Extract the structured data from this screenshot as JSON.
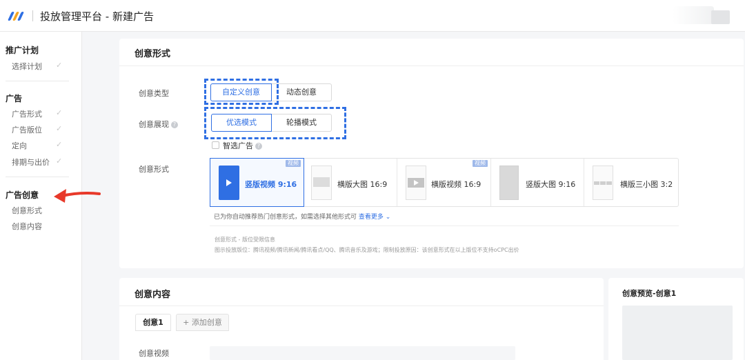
{
  "header": {
    "app_title": "投放管理平台 - 新建广告"
  },
  "sidebar": {
    "groups": [
      {
        "label": "推广计划",
        "items": [
          {
            "label": "选择计划",
            "check": "✓"
          }
        ]
      },
      {
        "label": "广告",
        "items": [
          {
            "label": "广告形式",
            "check": "✓"
          },
          {
            "label": "广告版位",
            "check": "✓"
          },
          {
            "label": "定向",
            "check": "✓"
          },
          {
            "label": "排期与出价",
            "check": "✓"
          }
        ]
      },
      {
        "label": "广告创意",
        "items": [
          {
            "label": "创意形式"
          },
          {
            "label": "创意内容"
          }
        ]
      }
    ],
    "arrow_color": "#e8392a"
  },
  "format_panel": {
    "title": "创意形式",
    "type_label": "创意类型",
    "type_options": [
      "自定义创意",
      "动态创意"
    ],
    "type_selected": "自定义创意",
    "display_label": "创意展现",
    "display_options": [
      "优选模式",
      "轮播模式"
    ],
    "display_selected": "优选模式",
    "smart_ad_label": "智选广告",
    "form_label": "创意形式",
    "formats": [
      {
        "label": "竖版视频 9:16",
        "tag": "视频",
        "selected": true,
        "icon": "play-icon"
      },
      {
        "label": "横版大图 16:9",
        "tag": ""
      },
      {
        "label": "横版视频 16:9",
        "tag": "视频",
        "icon": "play-icon"
      },
      {
        "label": "竖版大图 9:16",
        "tag": ""
      },
      {
        "label": "横版三小图 3:2",
        "tag": ""
      }
    ],
    "hint_text": "已为你自动推荐热门创意形式，如需选择其他形式可",
    "hint_link": "查看更多",
    "note_title": "创意形式 - 版位受限信息",
    "note_text": "图示投放版位：腾讯视频/腾讯新闻/腾讯看点/QQ、腾讯音乐及游戏；限制投放原因：该创意形式在以上版位不支持oCPC出价"
  },
  "content_panel": {
    "title": "创意内容",
    "tabs": [
      "创意1"
    ],
    "add_tab": "+ 添加创意",
    "video_label": "创意视频"
  },
  "preview_panel": {
    "title": "创意预览-创意1"
  },
  "colors": {
    "accent": "#2f6fe3",
    "arrow": "#e8392a"
  }
}
